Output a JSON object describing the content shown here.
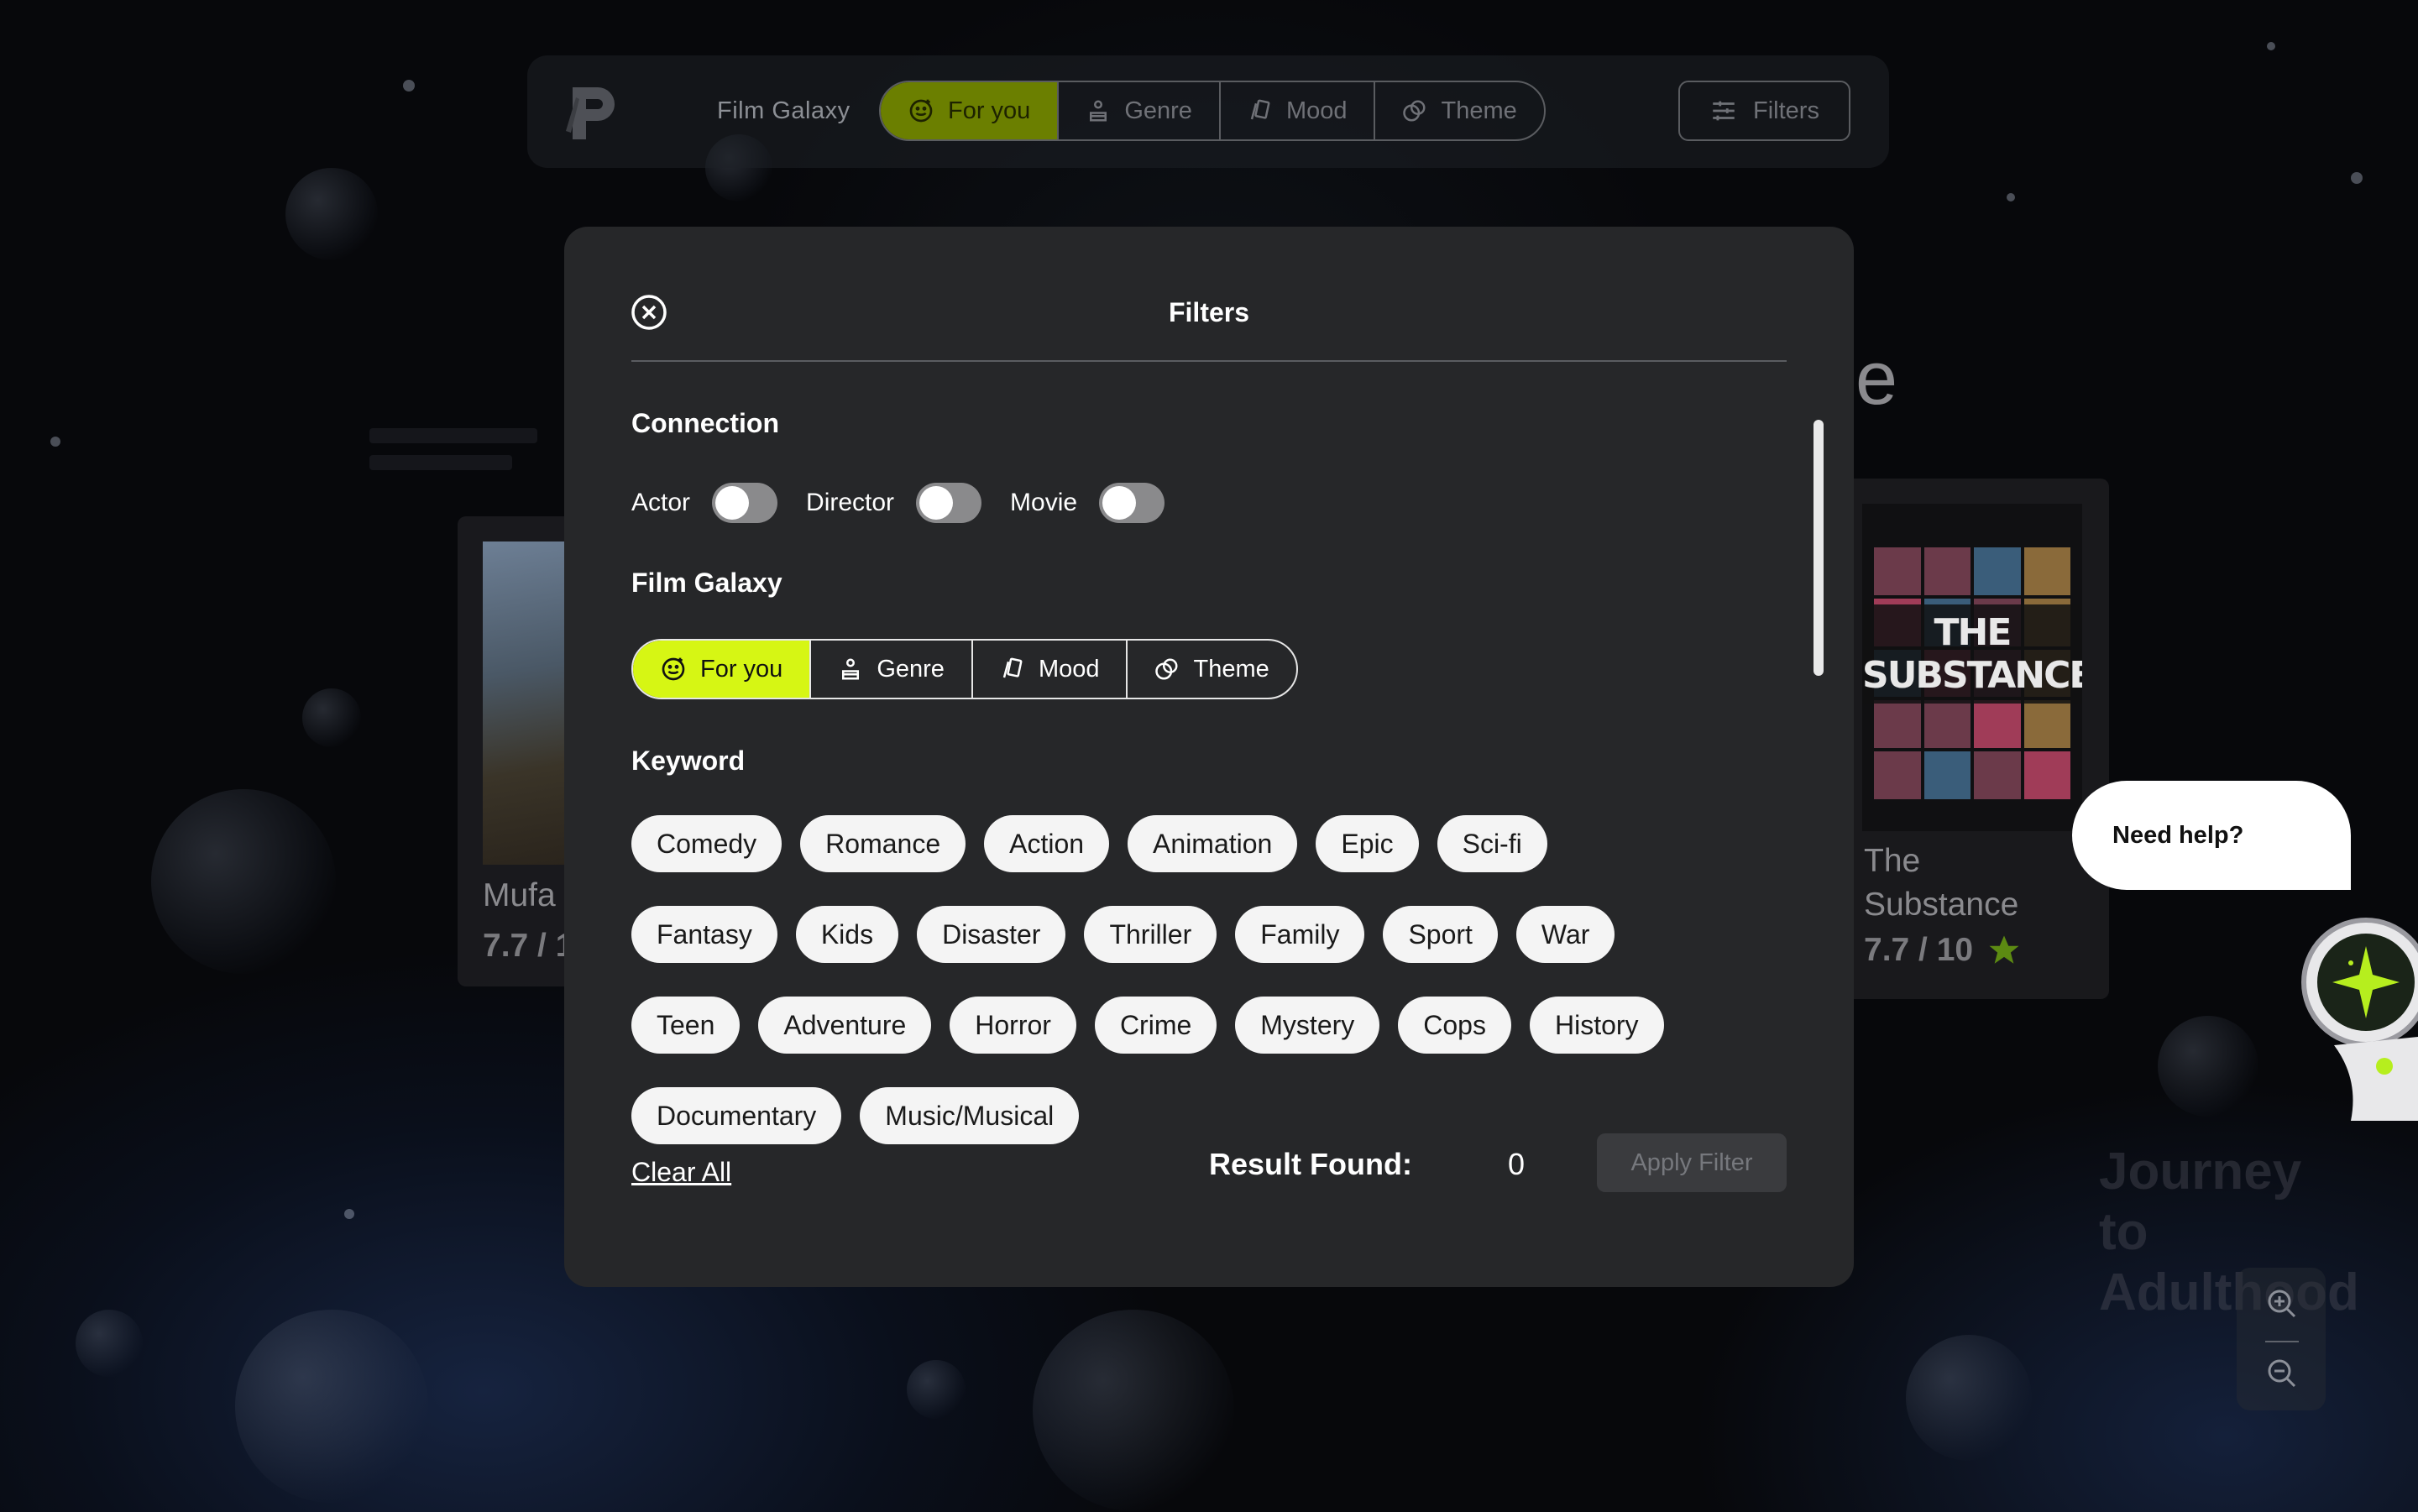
{
  "topbar": {
    "title": "Film Galaxy",
    "tabs": [
      {
        "label": "For you",
        "icon": "smile-icon",
        "active": true
      },
      {
        "label": "Genre",
        "icon": "person-icon",
        "active": false
      },
      {
        "label": "Mood",
        "icon": "cards-icon",
        "active": false
      },
      {
        "label": "Theme",
        "icon": "theme-icon",
        "active": false
      }
    ],
    "filters_label": "Filters"
  },
  "background_cards": {
    "left": {
      "title": "Mufa",
      "rating": "7.7 / 1"
    },
    "right": {
      "poster_title": "THE SUBSTANCE",
      "title": "The Substance",
      "rating": "7.7 / 10"
    },
    "partial_heading": "e",
    "faint_text": "Journey to Adulthood"
  },
  "modal": {
    "title": "Filters",
    "connection": {
      "heading": "Connection",
      "toggles": [
        {
          "label": "Actor",
          "on": false
        },
        {
          "label": "Director",
          "on": false
        },
        {
          "label": "Movie",
          "on": false
        }
      ]
    },
    "film_galaxy": {
      "heading": "Film Galaxy",
      "tabs": [
        {
          "label": "For you",
          "icon": "smile-icon",
          "active": true
        },
        {
          "label": "Genre",
          "icon": "person-icon",
          "active": false
        },
        {
          "label": "Mood",
          "icon": "cards-icon",
          "active": false
        },
        {
          "label": "Theme",
          "icon": "theme-icon",
          "active": false
        }
      ]
    },
    "keyword": {
      "heading": "Keyword",
      "chips": [
        "Comedy",
        "Romance",
        "Action",
        "Animation",
        "Epic",
        "Sci-fi",
        "Fantasy",
        "Kids",
        "Disaster",
        "Thriller",
        "Family",
        "Sport",
        "War",
        "Teen",
        "Adventure",
        "Horror",
        "Crime",
        "Mystery",
        "Cops",
        "History",
        "Documentary",
        "Music/Musical"
      ]
    },
    "footer": {
      "clear_all": "Clear All",
      "result_label": "Result Found:",
      "result_count": "0",
      "apply": "Apply Filter"
    }
  },
  "help": {
    "label": "Need help?"
  },
  "colors": {
    "accent": "#d6f614",
    "modal_bg": "#262729",
    "chip_bg": "#f4f4f4"
  }
}
